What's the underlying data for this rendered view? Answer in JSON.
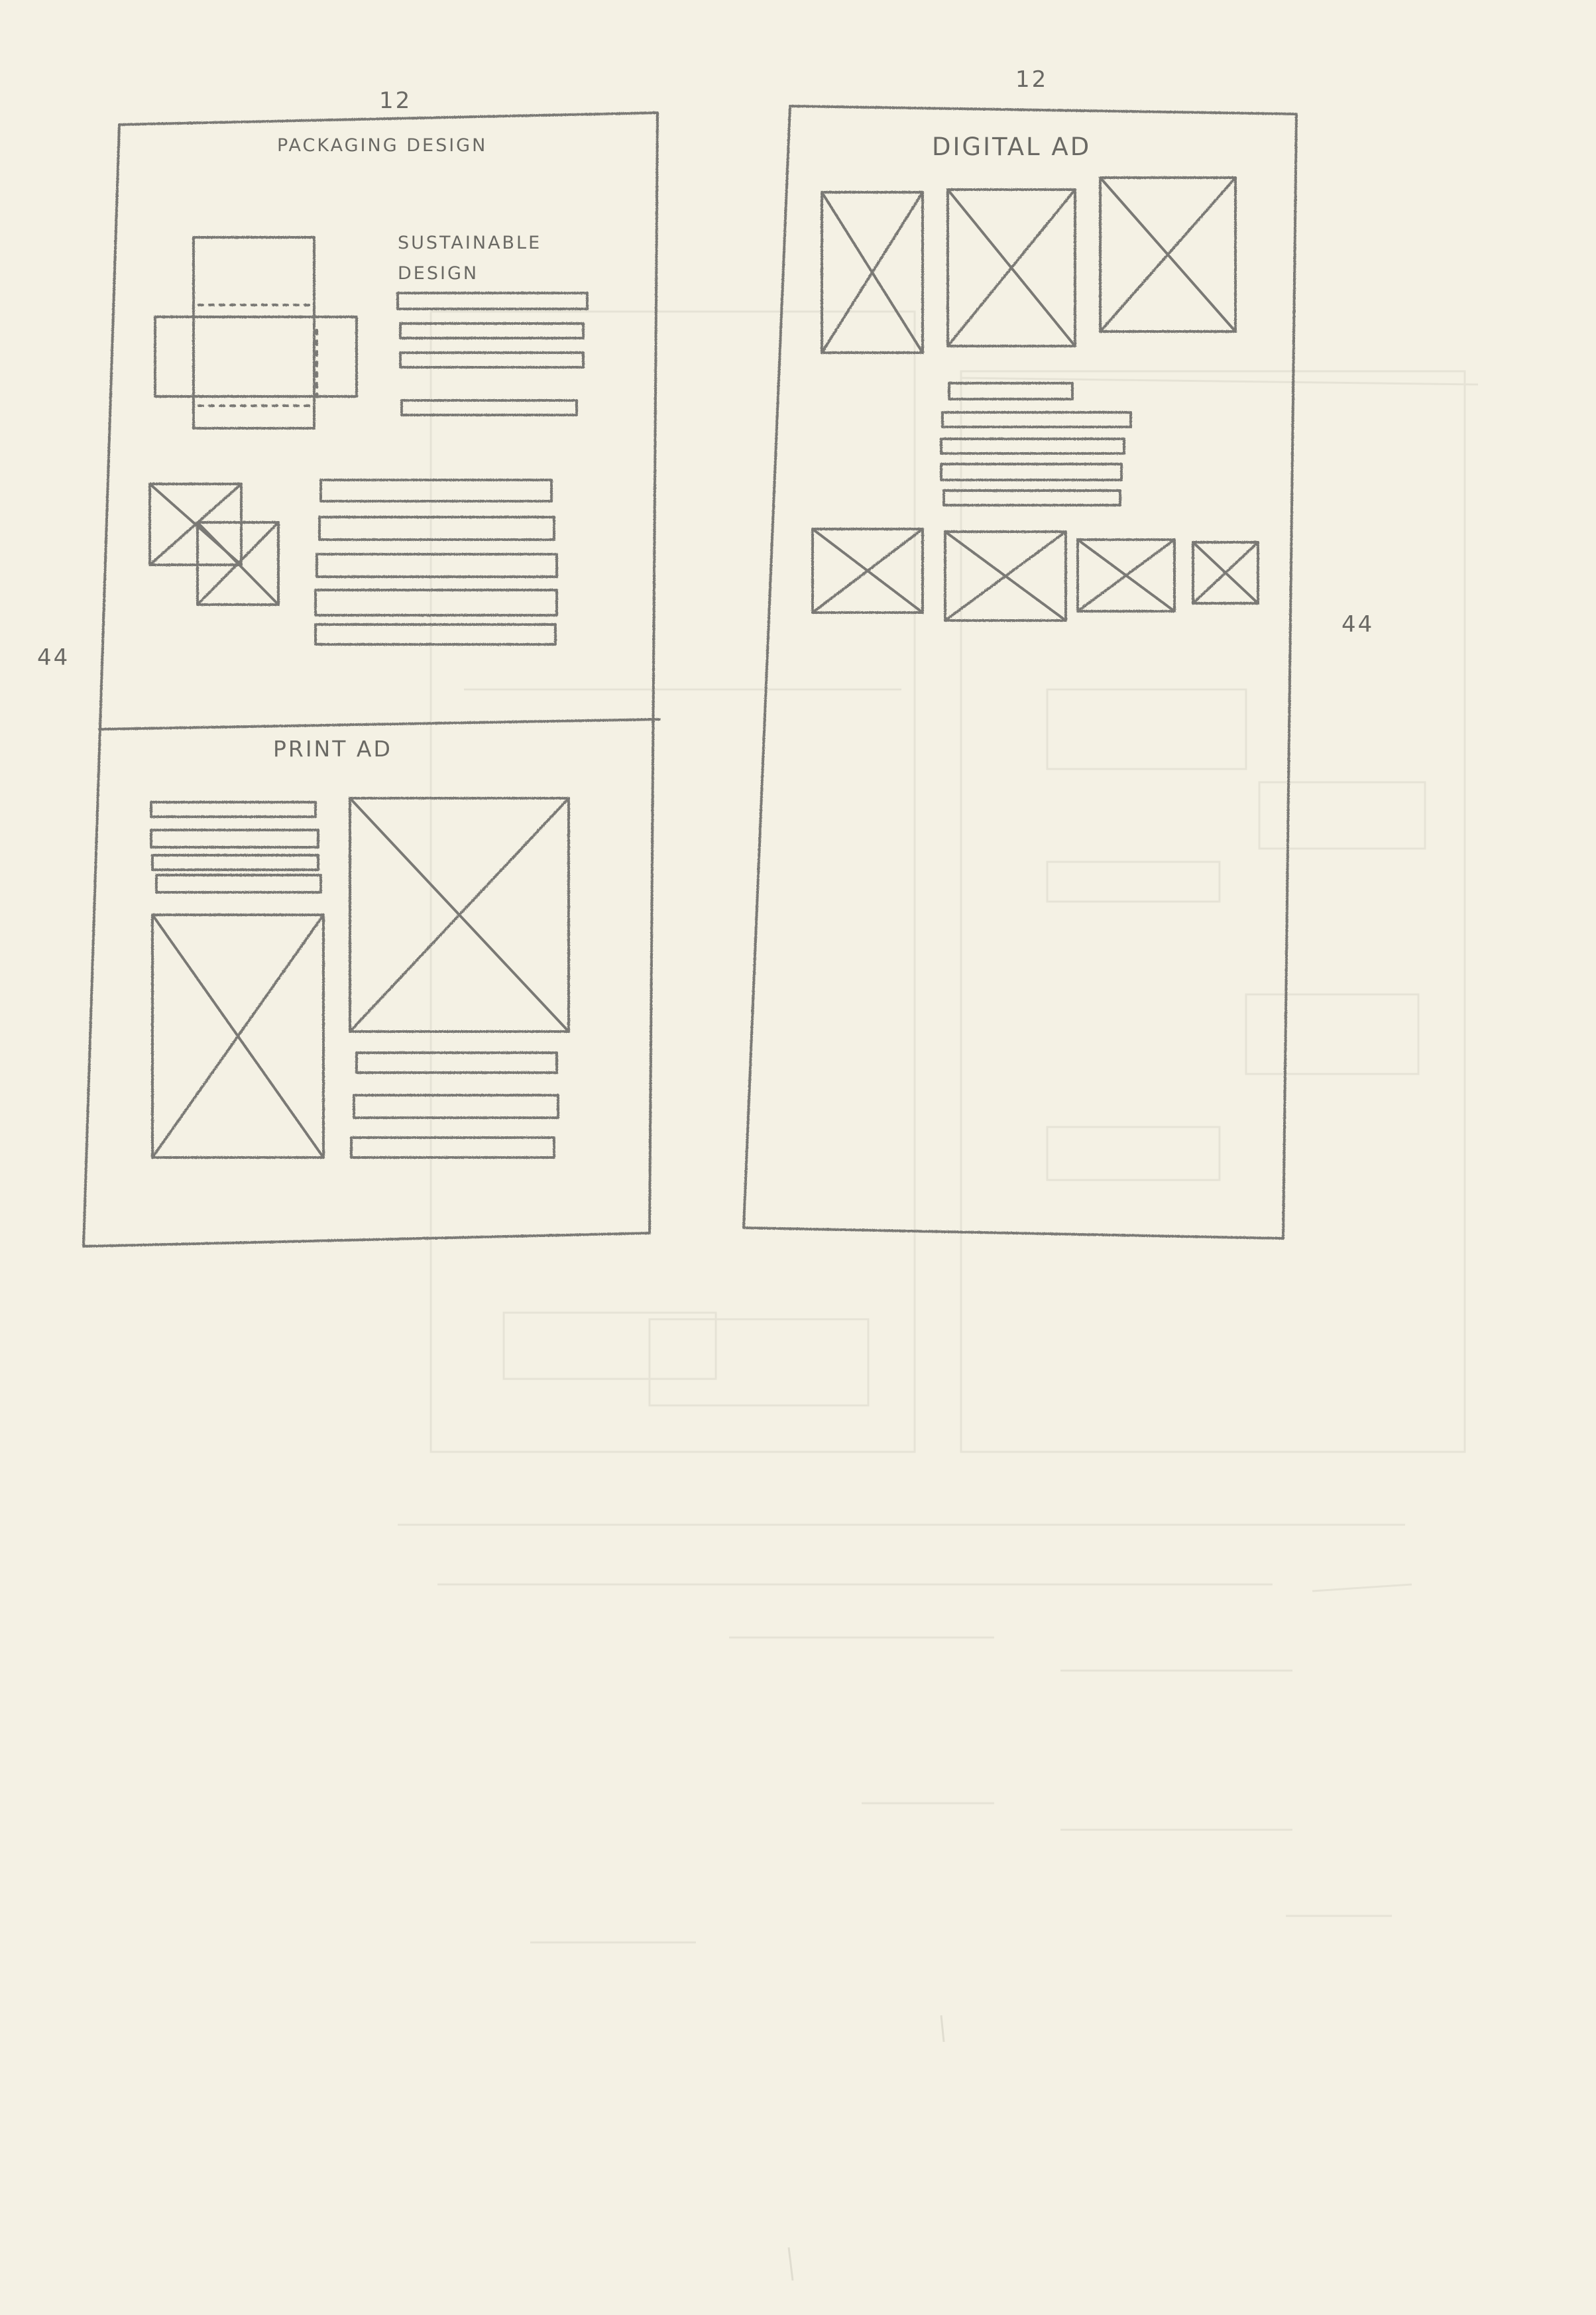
{
  "paper": {
    "background": "#f4f1e4",
    "pencil_color": "#7a7974",
    "ghost_color": "#e4e1d4"
  },
  "left_sheet": {
    "column_count": "12",
    "row_count": "44",
    "sections": {
      "packaging": {
        "title": "PACKAGING DESIGN",
        "subtitle": "SUSTAINABLE DESIGN"
      },
      "print": {
        "title": "PRINT AD"
      }
    }
  },
  "right_sheet": {
    "column_count": "12",
    "row_count": "44",
    "title": "DIGITAL AD"
  }
}
